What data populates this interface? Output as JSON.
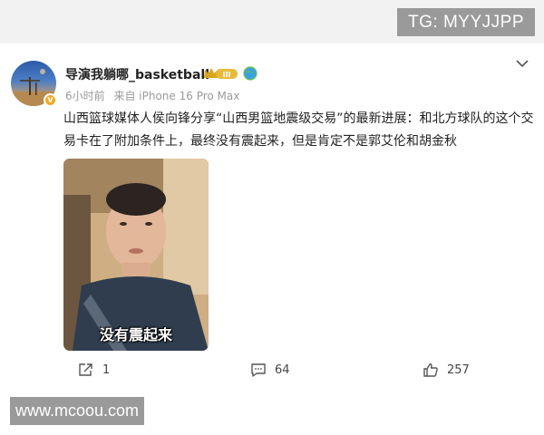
{
  "watermark_top": "TG: MYYJJPP",
  "watermark_bottom": "www.mcoou.com",
  "post": {
    "author": "导演我躺哪_basketball",
    "level_badge": "III",
    "time": "6小时前",
    "source": "来自 iPhone 16 Pro Max",
    "text": "山西篮球媒体人侯向锋分享“山西男篮地震级交易”的最新进展：和北方球队的这个交易卡在了附加条件上，最终没有震起来，但是肯定不是郭艾伦和胡金秋",
    "video_subtitle": "没有震起来"
  },
  "actions": {
    "share_count": "1",
    "comment_count": "64",
    "like_count": "257"
  },
  "icons": {
    "share": "share-icon",
    "comment": "comment-icon",
    "like": "thumbs-up-icon",
    "menu": "chevron-down-icon",
    "location": "globe-icon",
    "verified": "verified-badge-icon"
  },
  "colors": {
    "verified": "#f5a623",
    "meta_text": "#9a9a9a",
    "watermark_bg": "#9a9a9a"
  }
}
